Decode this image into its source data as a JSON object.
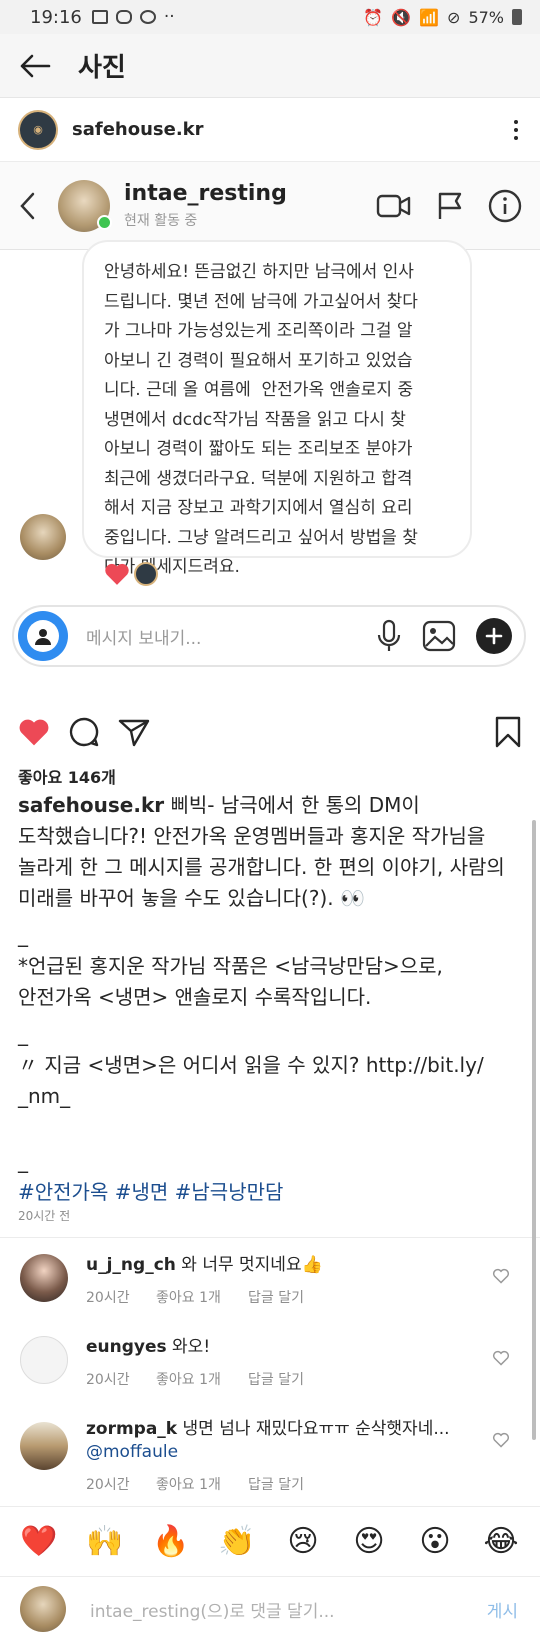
{
  "status_bar": {
    "time": "19:16",
    "dots": "··",
    "battery": "57%"
  },
  "app_bar": {
    "title": "사진"
  },
  "post_header": {
    "account": "safehouse.kr"
  },
  "screenshot": {
    "dm_user": "intae_resting",
    "dm_status": "현재 활동 중",
    "message_lines": [
      "안녕하세요! 뜬금없긴 하지만 남극에서 인사",
      "드립니다. 몇년 전에 남극에 가고싶어서 찾다",
      "가 그나마 가능성있는게 조리쪽이라 그걸 알",
      "아보니 긴 경력이 필요해서 포기하고 있었습",
      "니다. 근데 올 여름에  안전가옥 앤솔로지 중",
      "냉면에서 dcdc작가님 작품을 읽고 다시 찾",
      "아보니 경력이 짧아도 되는 조리보조 분야가",
      "최근에 생겼더라구요. 덕분에 지원하고 합격",
      "해서 지금 장보고 과학기지에서 열심히 요리",
      "중입니다. 그냥 알려드리고 싶어서 방법을 찾",
      "다가 메세지드려요."
    ],
    "composer_placeholder": "메시지 보내기..."
  },
  "likes": "좋아요 146개",
  "caption": {
    "handle": "safehouse.kr",
    "line1_rest": " 삐빅- 남극에서 한 통의 DM이",
    "line2": "도착했습니다?! 안전가옥 운영멤버들과 홍지운 작가님을",
    "line3": "놀라게 한 그 메시지를 공개합니다. 한 편의 이야기, 사람의",
    "line4": "미래를 바꾸어 놓을 수도 있습니다(?). 👀",
    "sep1": "_",
    "line5": "*언급된 홍지운 작가님 작품은 <남극낭만담>으로,",
    "line6": "안전가옥 <냉면> 앤솔로지 수록작입니다.",
    "sep2": "_",
    "line7": "〃 지금 <냉면>은 어디서 읽을 수 있지? http://bit.ly/",
    "line8": "_nm_",
    "sep3": "_",
    "hashtags": [
      "#안전가옥",
      "#냉면",
      "#남극낭만담"
    ]
  },
  "post_time": "20시간 전",
  "comments": [
    {
      "user": "u_j_ng_ch",
      "text": " 와 너무 멋지네요👍",
      "mention": "",
      "time": "20시간",
      "likes": "좋아요 1개",
      "reply": "답글 달기"
    },
    {
      "user": "eungyes",
      "text": " 와오!",
      "mention": "",
      "time": "20시간",
      "likes": "좋아요 1개",
      "reply": "답글 달기"
    },
    {
      "user": "zormpa_k",
      "text": " 냉면 넘나 재밌다요ㅠㅠ 순삭햇자네...",
      "mention": "@moffaule",
      "time": "20시간",
      "likes": "좋아요 1개",
      "reply": "답글 달기"
    }
  ],
  "emoji_bar": [
    "❤️",
    "🙌",
    "🔥",
    "👏",
    "😢",
    "😍",
    "😮",
    "😂"
  ],
  "bottom_comment": {
    "placeholder": "intae_resting(으)로 댓글 달기...",
    "post": "게시"
  },
  "colors": {
    "like_red": "#ed4956",
    "link_blue": "#1c4e8f",
    "post_disabled": "#8fbde8",
    "online_green": "#3fc552"
  }
}
